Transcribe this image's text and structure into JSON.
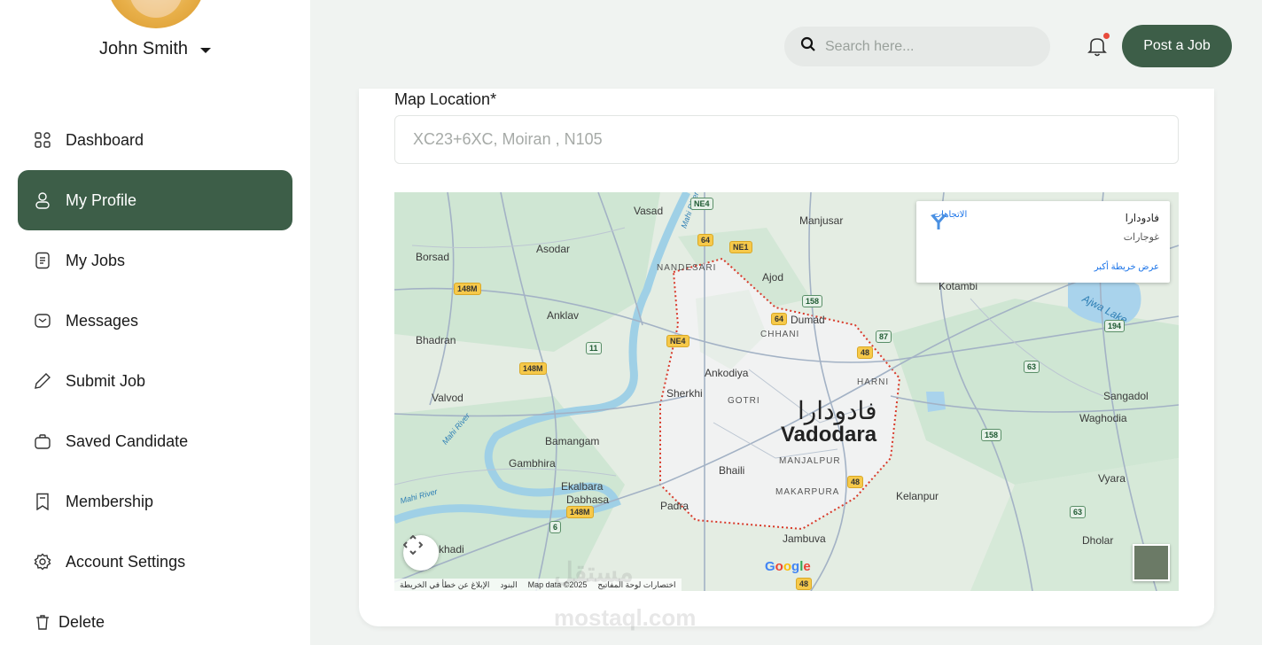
{
  "user": {
    "name": "John Smith"
  },
  "sidebar": {
    "items": [
      {
        "label": "Dashboard",
        "icon": "grid-icon",
        "active": false
      },
      {
        "label": "My Profile",
        "icon": "user-icon",
        "active": true
      },
      {
        "label": "My Jobs",
        "icon": "document-icon",
        "active": false
      },
      {
        "label": "Messages",
        "icon": "mail-icon",
        "active": false
      },
      {
        "label": "Submit Job",
        "icon": "pencil-icon",
        "active": false
      },
      {
        "label": "Saved Candidate",
        "icon": "briefcase-icon",
        "active": false
      },
      {
        "label": "Membership",
        "icon": "bookmark-icon",
        "active": false
      },
      {
        "label": "Account Settings",
        "icon": "gear-icon",
        "active": false
      },
      {
        "label": "Delete",
        "icon": "trash-icon",
        "active": false
      }
    ]
  },
  "header": {
    "search_placeholder": "Search here...",
    "post_job_label": "Post a Job"
  },
  "form": {
    "map_location_label": "Map Location*",
    "map_location_placeholder": "XC23+6XC, Moiran , N105"
  },
  "map": {
    "city_arabic": "فادودارا",
    "city_english": "Vadodara",
    "info_title": "فادودارا",
    "info_subtitle": "غوجارات",
    "info_directions": "الاتجاهات",
    "info_larger_map": "عرض خريطة أكبر",
    "google": "Google",
    "attribution": {
      "shortcuts": "اختصارات لوحة المفاتيح",
      "map_data": "Map data ©2025",
      "terms": "البنود",
      "report": "الإبلاغ عن خطأ في الخريطة"
    },
    "places": {
      "vasad": "Vasad",
      "manjusar": "Manjusar",
      "asodar": "Asodar",
      "borsad": "Borsad",
      "nandesari": "NANDESARI",
      "ajod": "Ajod",
      "kotambi": "Kotambi",
      "anklav": "Anklav",
      "dumad": "Dumad",
      "chhani": "CHHANI",
      "bhadran": "Bhadran",
      "ankodiya": "Ankodiya",
      "harni": "HARNI",
      "sherkhi": "Sherkhi",
      "gotri": "GOTRI",
      "valvod": "Valvod",
      "sangadol": "Sangadol",
      "waghodia": "Waghodia",
      "bamangam": "Bamangam",
      "gambhira": "Gambhira",
      "manjalpur": "MANJALPUR",
      "bhaili": "Bhaili",
      "ekalbara": "Ekalbara",
      "dabhasa": "Dabhasa",
      "makarpura": "MAKARPURA",
      "vyara": "Vyara",
      "kelanpur": "Kelanpur",
      "padra": "Padra",
      "jambuva": "Jambuva",
      "dholar": "Dholar",
      "khadi": "khadi",
      "ajwa_lake": "Ajwa Lake",
      "mahi_river_1": "Mahi River",
      "mahi_river_2": "Mahi River",
      "mahi_river_3": "Mahi River"
    },
    "shields": [
      "NE4",
      "64",
      "NE1",
      "148M",
      "158",
      "64",
      "87",
      "194",
      "11",
      "148M",
      "NE4",
      "48",
      "63",
      "158",
      "148M",
      "6",
      "48",
      "63",
      "48"
    ]
  },
  "watermark": {
    "text": "مستقل",
    "sub": "mostaql.com"
  },
  "colors": {
    "accent": "#3d5e48",
    "notification": "#e84b3c"
  }
}
